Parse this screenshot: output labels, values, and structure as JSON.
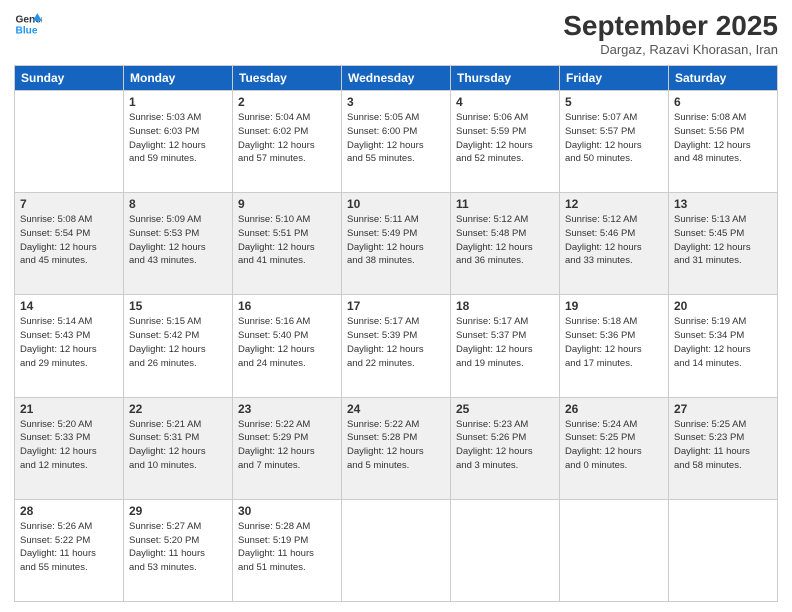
{
  "logo": {
    "line1": "General",
    "line2": "Blue"
  },
  "title": "September 2025",
  "location": "Dargaz, Razavi Khorasan, Iran",
  "headers": [
    "Sunday",
    "Monday",
    "Tuesday",
    "Wednesday",
    "Thursday",
    "Friday",
    "Saturday"
  ],
  "weeks": [
    [
      {
        "day": "",
        "info": ""
      },
      {
        "day": "1",
        "info": "Sunrise: 5:03 AM\nSunset: 6:03 PM\nDaylight: 12 hours\nand 59 minutes."
      },
      {
        "day": "2",
        "info": "Sunrise: 5:04 AM\nSunset: 6:02 PM\nDaylight: 12 hours\nand 57 minutes."
      },
      {
        "day": "3",
        "info": "Sunrise: 5:05 AM\nSunset: 6:00 PM\nDaylight: 12 hours\nand 55 minutes."
      },
      {
        "day": "4",
        "info": "Sunrise: 5:06 AM\nSunset: 5:59 PM\nDaylight: 12 hours\nand 52 minutes."
      },
      {
        "day": "5",
        "info": "Sunrise: 5:07 AM\nSunset: 5:57 PM\nDaylight: 12 hours\nand 50 minutes."
      },
      {
        "day": "6",
        "info": "Sunrise: 5:08 AM\nSunset: 5:56 PM\nDaylight: 12 hours\nand 48 minutes."
      }
    ],
    [
      {
        "day": "7",
        "info": "Sunrise: 5:08 AM\nSunset: 5:54 PM\nDaylight: 12 hours\nand 45 minutes."
      },
      {
        "day": "8",
        "info": "Sunrise: 5:09 AM\nSunset: 5:53 PM\nDaylight: 12 hours\nand 43 minutes."
      },
      {
        "day": "9",
        "info": "Sunrise: 5:10 AM\nSunset: 5:51 PM\nDaylight: 12 hours\nand 41 minutes."
      },
      {
        "day": "10",
        "info": "Sunrise: 5:11 AM\nSunset: 5:49 PM\nDaylight: 12 hours\nand 38 minutes."
      },
      {
        "day": "11",
        "info": "Sunrise: 5:12 AM\nSunset: 5:48 PM\nDaylight: 12 hours\nand 36 minutes."
      },
      {
        "day": "12",
        "info": "Sunrise: 5:12 AM\nSunset: 5:46 PM\nDaylight: 12 hours\nand 33 minutes."
      },
      {
        "day": "13",
        "info": "Sunrise: 5:13 AM\nSunset: 5:45 PM\nDaylight: 12 hours\nand 31 minutes."
      }
    ],
    [
      {
        "day": "14",
        "info": "Sunrise: 5:14 AM\nSunset: 5:43 PM\nDaylight: 12 hours\nand 29 minutes."
      },
      {
        "day": "15",
        "info": "Sunrise: 5:15 AM\nSunset: 5:42 PM\nDaylight: 12 hours\nand 26 minutes."
      },
      {
        "day": "16",
        "info": "Sunrise: 5:16 AM\nSunset: 5:40 PM\nDaylight: 12 hours\nand 24 minutes."
      },
      {
        "day": "17",
        "info": "Sunrise: 5:17 AM\nSunset: 5:39 PM\nDaylight: 12 hours\nand 22 minutes."
      },
      {
        "day": "18",
        "info": "Sunrise: 5:17 AM\nSunset: 5:37 PM\nDaylight: 12 hours\nand 19 minutes."
      },
      {
        "day": "19",
        "info": "Sunrise: 5:18 AM\nSunset: 5:36 PM\nDaylight: 12 hours\nand 17 minutes."
      },
      {
        "day": "20",
        "info": "Sunrise: 5:19 AM\nSunset: 5:34 PM\nDaylight: 12 hours\nand 14 minutes."
      }
    ],
    [
      {
        "day": "21",
        "info": "Sunrise: 5:20 AM\nSunset: 5:33 PM\nDaylight: 12 hours\nand 12 minutes."
      },
      {
        "day": "22",
        "info": "Sunrise: 5:21 AM\nSunset: 5:31 PM\nDaylight: 12 hours\nand 10 minutes."
      },
      {
        "day": "23",
        "info": "Sunrise: 5:22 AM\nSunset: 5:29 PM\nDaylight: 12 hours\nand 7 minutes."
      },
      {
        "day": "24",
        "info": "Sunrise: 5:22 AM\nSunset: 5:28 PM\nDaylight: 12 hours\nand 5 minutes."
      },
      {
        "day": "25",
        "info": "Sunrise: 5:23 AM\nSunset: 5:26 PM\nDaylight: 12 hours\nand 3 minutes."
      },
      {
        "day": "26",
        "info": "Sunrise: 5:24 AM\nSunset: 5:25 PM\nDaylight: 12 hours\nand 0 minutes."
      },
      {
        "day": "27",
        "info": "Sunrise: 5:25 AM\nSunset: 5:23 PM\nDaylight: 11 hours\nand 58 minutes."
      }
    ],
    [
      {
        "day": "28",
        "info": "Sunrise: 5:26 AM\nSunset: 5:22 PM\nDaylight: 11 hours\nand 55 minutes."
      },
      {
        "day": "29",
        "info": "Sunrise: 5:27 AM\nSunset: 5:20 PM\nDaylight: 11 hours\nand 53 minutes."
      },
      {
        "day": "30",
        "info": "Sunrise: 5:28 AM\nSunset: 5:19 PM\nDaylight: 11 hours\nand 51 minutes."
      },
      {
        "day": "",
        "info": ""
      },
      {
        "day": "",
        "info": ""
      },
      {
        "day": "",
        "info": ""
      },
      {
        "day": "",
        "info": ""
      }
    ]
  ]
}
